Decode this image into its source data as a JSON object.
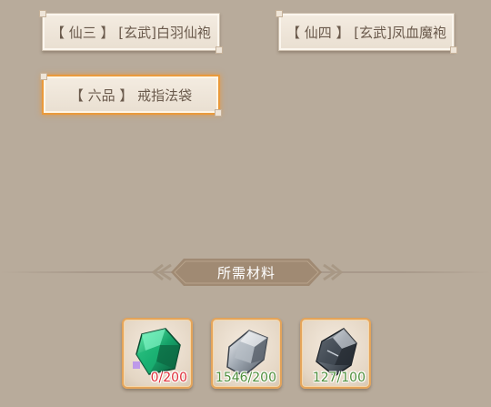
{
  "cards": [
    {
      "label": "【 仙三 】 [玄武]白羽仙袍",
      "selected": false
    },
    {
      "label": "【 仙四 】 [玄武]凤血魔袍",
      "selected": false
    },
    {
      "label": "【 六品 】 戒指法袋",
      "selected": true
    }
  ],
  "materials": {
    "title": "所需材料",
    "items": [
      {
        "icon": "green-gem-icon",
        "count": "0/200",
        "status_color": "#e0303a"
      },
      {
        "icon": "silver-ore-icon",
        "count": "1546/200",
        "status_color": "#4f8f3c"
      },
      {
        "icon": "dark-ore-icon",
        "count": "127/100",
        "status_color": "#4f8f3c"
      }
    ]
  },
  "colors": {
    "background": "#b8ab9b",
    "selected_border": "#e99a3c",
    "banner": "#a08a73"
  }
}
